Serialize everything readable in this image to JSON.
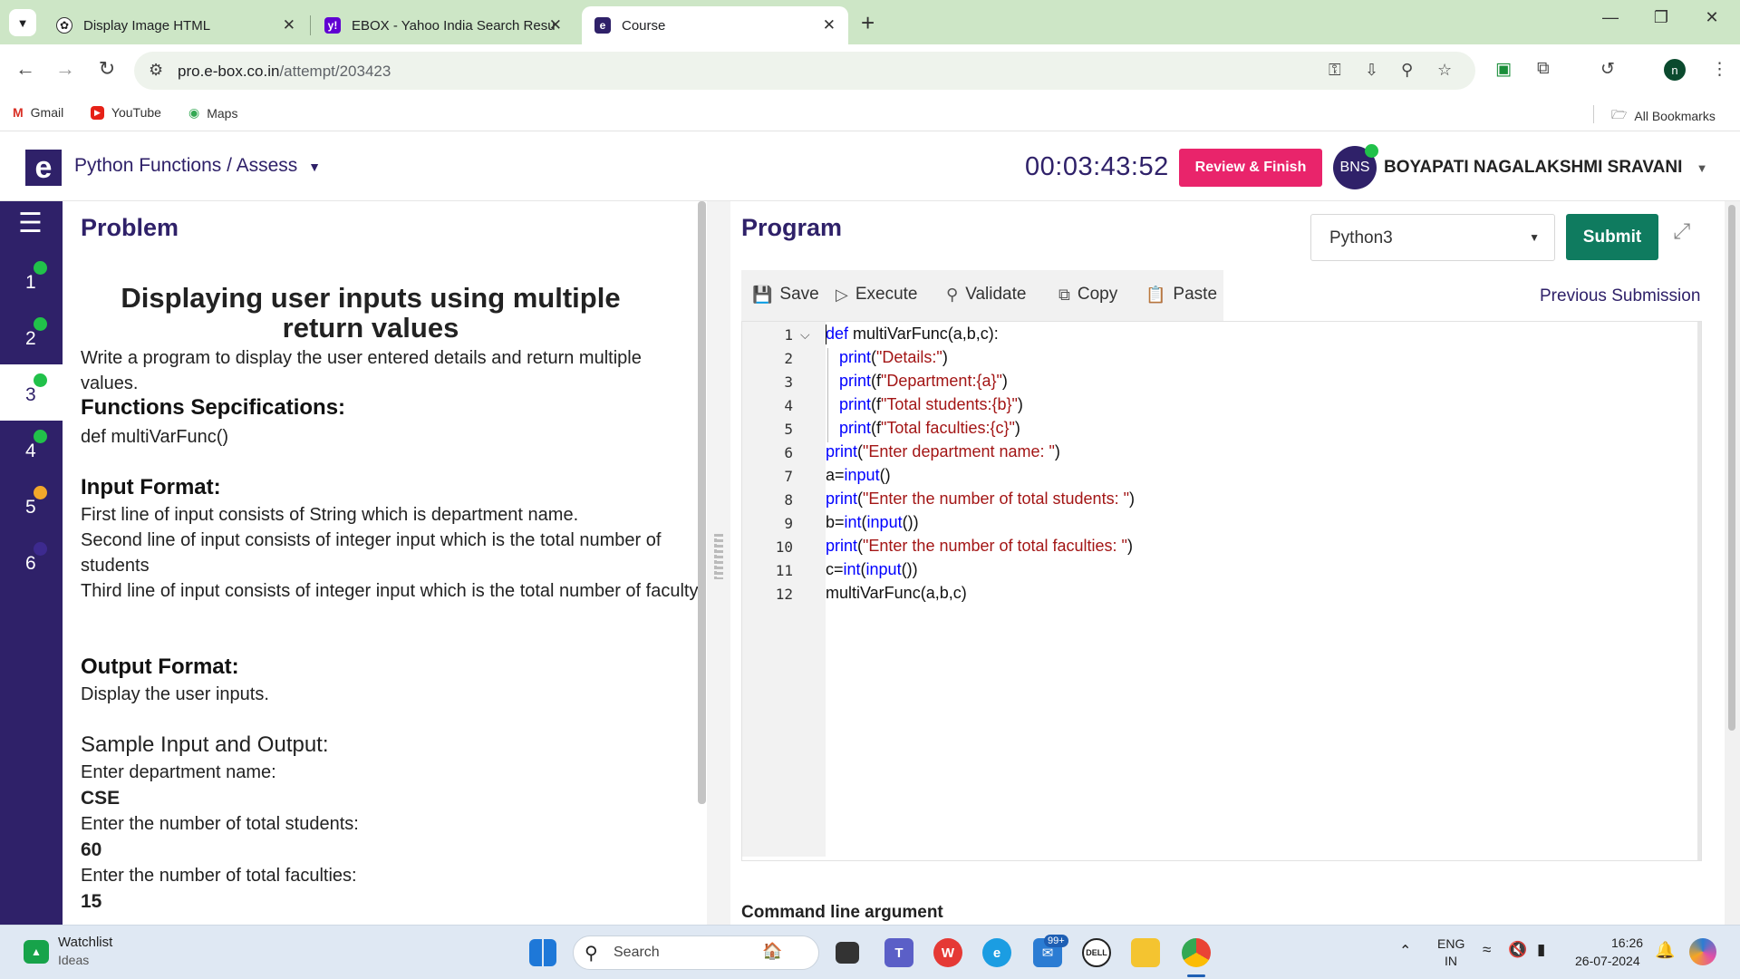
{
  "browser": {
    "tabs": [
      {
        "title": "Display Image HTML",
        "icon": "chatgpt-icon"
      },
      {
        "title": "EBOX - Yahoo India Search Resu",
        "icon": "yahoo-icon"
      },
      {
        "title": "Course",
        "icon": "ebox-icon",
        "active": true
      }
    ],
    "new_tab": "+",
    "url_host": "pro.e-box.co.in",
    "url_path": "/attempt/203423",
    "profile_initial": "n",
    "bookmarks": [
      "Gmail",
      "YouTube",
      "Maps"
    ],
    "all_bookmarks": "All Bookmarks"
  },
  "app": {
    "logo": "e",
    "breadcrumb": "Python Functions / Assess",
    "timer": "00:03:43:52",
    "review_finish": "Review & Finish",
    "avatar_initials": "BNS",
    "user_name": "BOYAPATI NAGALAKSHMI SRAVANI"
  },
  "sidebar": {
    "questions": [
      {
        "num": "1",
        "status": "#21c14a"
      },
      {
        "num": "2",
        "status": "#21c14a"
      },
      {
        "num": "3",
        "status": "#21c14a",
        "active": true
      },
      {
        "num": "4",
        "status": "#21c14a"
      },
      {
        "num": "5",
        "status": "#f2a72a"
      },
      {
        "num": "6",
        "status": "#3d2a8f"
      }
    ]
  },
  "problem": {
    "header": "Problem",
    "title": "Displaying user inputs using multiple return values",
    "description": "Write a program to display the user entered details and return multiple values.",
    "spec_heading": "Functions Sepcifications:",
    "spec": "def multiVarFunc()",
    "input_heading": "Input Format:",
    "input_lines": [
      "First line of input consists of String which is department name.",
      "Second line of input consists of integer input which is the total number of students",
      "Third line of input consists of integer input which is the total number of faculty."
    ],
    "output_heading": "Output Format:",
    "output_text": "Display the user inputs.",
    "sample_heading": "Sample Input and Output:",
    "sample": [
      {
        "text": "Enter department name:",
        "bold": false
      },
      {
        "text": "CSE",
        "bold": true
      },
      {
        "text": "Enter the number of total students:",
        "bold": false
      },
      {
        "text": "60",
        "bold": true
      },
      {
        "text": "Enter the number of total faculties:",
        "bold": false
      },
      {
        "text": "15",
        "bold": true
      }
    ]
  },
  "program": {
    "header": "Program",
    "language": "Python3",
    "submit": "Submit",
    "tools": [
      "Save",
      "Execute",
      "Validate",
      "Copy",
      "Paste"
    ],
    "previous_submission": "Previous Submission",
    "command_line": "Command line argument",
    "code": [
      {
        "n": "1",
        "indent": 0,
        "parts": [
          [
            "kw",
            "def"
          ],
          [
            "tx",
            " multiVarFunc(a,b,c):"
          ]
        ]
      },
      {
        "n": "2",
        "indent": 1,
        "parts": [
          [
            "kw",
            "print"
          ],
          [
            "tx",
            "("
          ],
          [
            "st",
            "\"Details:\""
          ],
          [
            "tx",
            ")"
          ]
        ]
      },
      {
        "n": "3",
        "indent": 1,
        "parts": [
          [
            "kw",
            "print"
          ],
          [
            "tx",
            "(f"
          ],
          [
            "st",
            "\"Department:{a}\""
          ],
          [
            "tx",
            ")"
          ]
        ]
      },
      {
        "n": "4",
        "indent": 1,
        "parts": [
          [
            "kw",
            "print"
          ],
          [
            "tx",
            "(f"
          ],
          [
            "st",
            "\"Total students:{b}\""
          ],
          [
            "tx",
            ")"
          ]
        ]
      },
      {
        "n": "5",
        "indent": 1,
        "parts": [
          [
            "kw",
            "print"
          ],
          [
            "tx",
            "(f"
          ],
          [
            "st",
            "\"Total faculties:{c}\""
          ],
          [
            "tx",
            ")"
          ]
        ]
      },
      {
        "n": "6",
        "indent": 0,
        "parts": [
          [
            "kw",
            "print"
          ],
          [
            "tx",
            "("
          ],
          [
            "st",
            "\"Enter department name: \""
          ],
          [
            "tx",
            ")"
          ]
        ]
      },
      {
        "n": "7",
        "indent": 0,
        "parts": [
          [
            "tx",
            "a="
          ],
          [
            "kw",
            "input"
          ],
          [
            "tx",
            "()"
          ]
        ]
      },
      {
        "n": "8",
        "indent": 0,
        "parts": [
          [
            "kw",
            "print"
          ],
          [
            "tx",
            "("
          ],
          [
            "st",
            "\"Enter the number of total students: \""
          ],
          [
            "tx",
            ")"
          ]
        ]
      },
      {
        "n": "9",
        "indent": 0,
        "parts": [
          [
            "tx",
            "b="
          ],
          [
            "kw",
            "int"
          ],
          [
            "tx",
            "("
          ],
          [
            "kw",
            "input"
          ],
          [
            "tx",
            "())"
          ]
        ]
      },
      {
        "n": "10",
        "indent": 0,
        "parts": [
          [
            "kw",
            "print"
          ],
          [
            "tx",
            "("
          ],
          [
            "st",
            "\"Enter the number of total faculties: \""
          ],
          [
            "tx",
            ")"
          ]
        ]
      },
      {
        "n": "11",
        "indent": 0,
        "parts": [
          [
            "tx",
            "c="
          ],
          [
            "kw",
            "int"
          ],
          [
            "tx",
            "("
          ],
          [
            "kw",
            "input"
          ],
          [
            "tx",
            "())"
          ]
        ]
      },
      {
        "n": "12",
        "indent": 0,
        "parts": [
          [
            "tx",
            "multiVarFunc(a,b,c)"
          ]
        ]
      }
    ]
  },
  "taskbar": {
    "widget_title": "Watchlist",
    "widget_sub": "Ideas",
    "search": "Search",
    "mail_badge": "99+",
    "lang": "ENG",
    "region": "IN",
    "time": "16:26",
    "date": "26-07-2024"
  }
}
